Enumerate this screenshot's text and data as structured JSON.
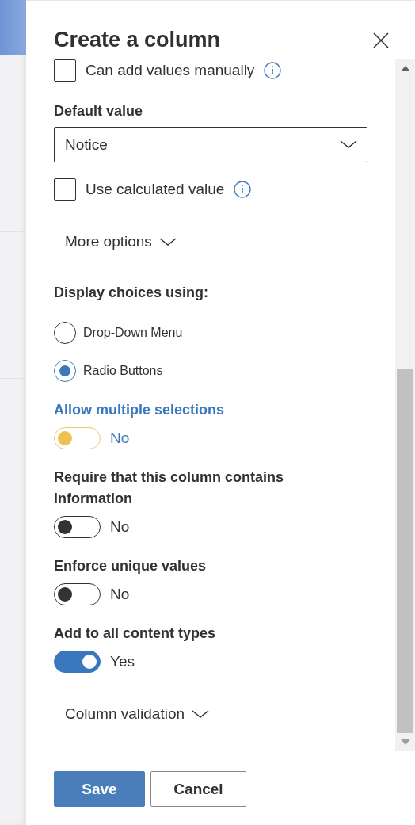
{
  "panel": {
    "title": "Create a column"
  },
  "fields": [
    {
      "kind": "checkbox",
      "label": "Can add values manually",
      "checked": false,
      "info": true
    },
    {
      "kind": "heading",
      "text": "Default value"
    },
    {
      "kind": "dropdown",
      "value": "Notice"
    },
    {
      "kind": "checkbox",
      "label": "Use calculated value",
      "checked": false,
      "info": true
    },
    {
      "kind": "expander",
      "label": "More options",
      "expanded": false
    },
    {
      "kind": "heading",
      "text": "Display choices using:"
    },
    {
      "kind": "radio",
      "label": "Drop-Down Menu",
      "selected": false
    },
    {
      "kind": "radio",
      "label": "Radio Buttons",
      "selected": true
    },
    {
      "kind": "toggle",
      "label": "Allow multiple selections",
      "on": false,
      "focused": true,
      "state": "No"
    },
    {
      "kind": "toggle",
      "label": "Require that this column contains information",
      "on": false,
      "focused": false,
      "state": "No"
    },
    {
      "kind": "toggle",
      "label": "Enforce unique values",
      "on": false,
      "focused": false,
      "state": "No"
    },
    {
      "kind": "toggle",
      "label": "Add to all content types",
      "on": true,
      "focused": false,
      "state": "Yes"
    },
    {
      "kind": "expander",
      "label": "Column validation",
      "expanded": false
    }
  ],
  "buttons": [
    {
      "label": "Save",
      "primary": true
    },
    {
      "label": "Cancel",
      "primary": false
    }
  ]
}
